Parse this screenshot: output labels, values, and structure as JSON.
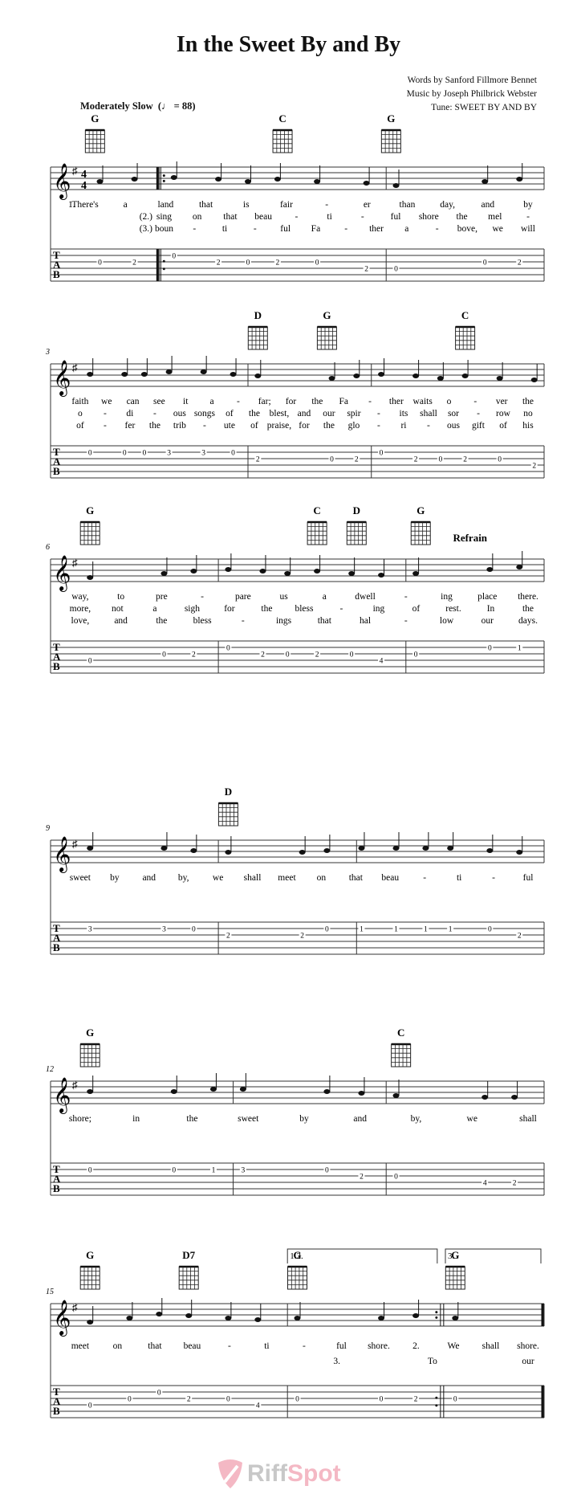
{
  "title": "In the Sweet By and By",
  "credits": {
    "words": "Words by Sanford Fillmore Bennet",
    "music": "Music by Joseph Philbrick Webster",
    "tune": "Tune: SWEET BY AND BY"
  },
  "tempo": {
    "label": "Moderately Slow",
    "bpm_text": "(♩ = 88)"
  },
  "refrain_label": "Refrain",
  "watermark": {
    "part1": "Riff",
    "part2": "Spot",
    "color1": "#c8c8c8",
    "color2": "#f4b8c4"
  },
  "systems": [
    {
      "number": "",
      "chords": [
        {
          "name": "G",
          "pos": 0.09
        },
        {
          "name": "C",
          "pos": 0.47
        },
        {
          "name": "G",
          "pos": 0.69
        }
      ],
      "barlines": [
        0.22,
        0.68
      ],
      "repeat_start_at": 0.22,
      "verse_labels": [
        "1.",
        "(2.)",
        "(3.)"
      ],
      "lyrics": [
        [
          "There's",
          "a",
          "land",
          "that",
          "is",
          "fair",
          "-",
          "er",
          "than",
          "day,",
          "and",
          "by"
        ],
        [
          "sing",
          "on",
          "that",
          "beau",
          "-",
          "ti",
          "-",
          "ful",
          "shore",
          "the",
          "mel",
          "-"
        ],
        [
          "boun",
          "-",
          "ti",
          "-",
          "ful",
          "Fa",
          "-",
          "ther",
          "a",
          "-",
          "bove,",
          "we",
          "will"
        ]
      ],
      "tab": [
        {
          "s": 3,
          "f": "0",
          "p": 0.1
        },
        {
          "s": 3,
          "f": "2",
          "p": 0.17
        },
        {
          "s": 2,
          "f": "0",
          "p": 0.25
        },
        {
          "s": 3,
          "f": "2",
          "p": 0.34
        },
        {
          "s": 3,
          "f": "0",
          "p": 0.4
        },
        {
          "s": 3,
          "f": "2",
          "p": 0.46
        },
        {
          "s": 3,
          "f": "0",
          "p": 0.54
        },
        {
          "s": 4,
          "f": "2",
          "p": 0.64
        },
        {
          "s": 4,
          "f": "0",
          "p": 0.7
        },
        {
          "s": 3,
          "f": "0",
          "p": 0.88
        },
        {
          "s": 3,
          "f": "2",
          "p": 0.95
        }
      ]
    },
    {
      "number": "3",
      "chords": [
        {
          "name": "D",
          "pos": 0.42
        },
        {
          "name": "G",
          "pos": 0.56
        },
        {
          "name": "C",
          "pos": 0.84
        }
      ],
      "barlines": [
        0.4,
        0.65
      ],
      "lyrics": [
        [
          "faith",
          "we",
          "can",
          "see",
          "it",
          "a",
          "-",
          "far;",
          "for",
          "the",
          "Fa",
          "-",
          "ther",
          "waits",
          "o",
          "-",
          "ver",
          "the"
        ],
        [
          "o",
          "-",
          "di",
          "-",
          "ous",
          "songs",
          "of",
          "the",
          "blest,",
          "and",
          "our",
          "spir",
          "-",
          "its",
          "shall",
          "sor",
          "-",
          "row",
          "no"
        ],
        [
          "of",
          "-",
          "fer",
          "the",
          "trib",
          "-",
          "ute",
          "of",
          "praise,",
          "for",
          "the",
          "glo",
          "-",
          "ri",
          "-",
          "ous",
          "gift",
          "of",
          "his"
        ]
      ],
      "tab": [
        {
          "s": 2,
          "f": "0",
          "p": 0.08
        },
        {
          "s": 2,
          "f": "0",
          "p": 0.15
        },
        {
          "s": 2,
          "f": "0",
          "p": 0.19
        },
        {
          "s": 2,
          "f": "3",
          "p": 0.24
        },
        {
          "s": 2,
          "f": "3",
          "p": 0.31
        },
        {
          "s": 2,
          "f": "0",
          "p": 0.37
        },
        {
          "s": 3,
          "f": "2",
          "p": 0.42
        },
        {
          "s": 3,
          "f": "0",
          "p": 0.57
        },
        {
          "s": 3,
          "f": "2",
          "p": 0.62
        },
        {
          "s": 2,
          "f": "0",
          "p": 0.67
        },
        {
          "s": 3,
          "f": "2",
          "p": 0.74
        },
        {
          "s": 3,
          "f": "0",
          "p": 0.79
        },
        {
          "s": 3,
          "f": "2",
          "p": 0.84
        },
        {
          "s": 3,
          "f": "0",
          "p": 0.91
        },
        {
          "s": 4,
          "f": "2",
          "p": 0.98
        }
      ]
    },
    {
      "number": "6",
      "chords": [
        {
          "name": "G",
          "pos": 0.08
        },
        {
          "name": "C",
          "pos": 0.54
        },
        {
          "name": "D",
          "pos": 0.62
        },
        {
          "name": "G",
          "pos": 0.75
        }
      ],
      "barlines": [
        0.34,
        0.72
      ],
      "lyrics": [
        [
          "way,",
          "to",
          "pre",
          "-",
          "pare",
          "us",
          "a",
          "dwell",
          "-",
          "ing",
          "place",
          "there."
        ],
        [
          "more,",
          "not",
          "a",
          "sigh",
          "for",
          "the",
          "bless",
          "-",
          "ing",
          "of",
          "rest.",
          "In",
          "the"
        ],
        [
          "love,",
          "and",
          "the",
          "bless",
          "-",
          "ings",
          "that",
          "hal",
          "-",
          "low",
          "our",
          "days."
        ]
      ],
      "tab": [
        {
          "s": 4,
          "f": "0",
          "p": 0.08
        },
        {
          "s": 3,
          "f": "0",
          "p": 0.23
        },
        {
          "s": 3,
          "f": "2",
          "p": 0.29
        },
        {
          "s": 2,
          "f": "0",
          "p": 0.36
        },
        {
          "s": 3,
          "f": "2",
          "p": 0.43
        },
        {
          "s": 3,
          "f": "0",
          "p": 0.48
        },
        {
          "s": 3,
          "f": "2",
          "p": 0.54
        },
        {
          "s": 3,
          "f": "0",
          "p": 0.61
        },
        {
          "s": 4,
          "f": "4",
          "p": 0.67
        },
        {
          "s": 3,
          "f": "0",
          "p": 0.74
        },
        {
          "s": 2,
          "f": "0",
          "p": 0.89
        },
        {
          "s": 2,
          "f": "1",
          "p": 0.95
        }
      ]
    },
    {
      "number": "9",
      "chords": [
        {
          "name": "D",
          "pos": 0.36
        }
      ],
      "barlines": [
        0.34,
        0.62
      ],
      "lyrics": [
        [
          "sweet",
          "by",
          "and",
          "by,",
          "we",
          "shall",
          "meet",
          "on",
          "that",
          "beau",
          "-",
          "ti",
          "-",
          "ful"
        ]
      ],
      "tab": [
        {
          "s": 2,
          "f": "3",
          "p": 0.08
        },
        {
          "s": 2,
          "f": "3",
          "p": 0.23
        },
        {
          "s": 2,
          "f": "0",
          "p": 0.29
        },
        {
          "s": 3,
          "f": "2",
          "p": 0.36
        },
        {
          "s": 3,
          "f": "2",
          "p": 0.51
        },
        {
          "s": 2,
          "f": "0",
          "p": 0.56
        },
        {
          "s": 2,
          "f": "1",
          "p": 0.63
        },
        {
          "s": 2,
          "f": "1",
          "p": 0.7
        },
        {
          "s": 2,
          "f": "1",
          "p": 0.76
        },
        {
          "s": 2,
          "f": "1",
          "p": 0.81
        },
        {
          "s": 2,
          "f": "0",
          "p": 0.89
        },
        {
          "s": 3,
          "f": "2",
          "p": 0.95
        }
      ]
    },
    {
      "number": "12",
      "chords": [
        {
          "name": "G",
          "pos": 0.08
        },
        {
          "name": "C",
          "pos": 0.71
        }
      ],
      "barlines": [
        0.37,
        0.68
      ],
      "lyrics": [
        [
          "shore;",
          "in",
          "the",
          "sweet",
          "by",
          "and",
          "by,",
          "we",
          "shall"
        ]
      ],
      "tab": [
        {
          "s": 2,
          "f": "0",
          "p": 0.08
        },
        {
          "s": 2,
          "f": "0",
          "p": 0.25
        },
        {
          "s": 2,
          "f": "1",
          "p": 0.33
        },
        {
          "s": 2,
          "f": "3",
          "p": 0.39
        },
        {
          "s": 2,
          "f": "0",
          "p": 0.56
        },
        {
          "s": 3,
          "f": "2",
          "p": 0.63
        },
        {
          "s": 3,
          "f": "0",
          "p": 0.7
        },
        {
          "s": 4,
          "f": "4",
          "p": 0.88
        },
        {
          "s": 4,
          "f": "2",
          "p": 0.94
        }
      ]
    },
    {
      "number": "15",
      "chords": [
        {
          "name": "G",
          "pos": 0.08
        },
        {
          "name": "D7",
          "pos": 0.28
        },
        {
          "name": "G",
          "pos": 0.5
        },
        {
          "name": "G",
          "pos": 0.82
        }
      ],
      "barlines": [
        0.48
      ],
      "repeat_end_at": 0.79,
      "endings": [
        {
          "label": "1.2.",
          "from": 0.48,
          "to": 0.79
        },
        {
          "label": "3.",
          "from": 0.8,
          "to": 1.0
        }
      ],
      "lyrics": [
        [
          "meet",
          "on",
          "that",
          "beau",
          "-",
          "ti",
          "-",
          "ful",
          "shore.",
          "2.",
          "We",
          "shall",
          "shore."
        ],
        [
          "3.",
          "To",
          "our"
        ]
      ],
      "tab": [
        {
          "s": 4,
          "f": "0",
          "p": 0.08
        },
        {
          "s": 3,
          "f": "0",
          "p": 0.16
        },
        {
          "s": 2,
          "f": "0",
          "p": 0.22
        },
        {
          "s": 3,
          "f": "2",
          "p": 0.28
        },
        {
          "s": 3,
          "f": "0",
          "p": 0.36
        },
        {
          "s": 4,
          "f": "4",
          "p": 0.42
        },
        {
          "s": 3,
          "f": "0",
          "p": 0.5
        },
        {
          "s": 3,
          "f": "0",
          "p": 0.67
        },
        {
          "s": 3,
          "f": "2",
          "p": 0.74
        },
        {
          "s": 3,
          "f": "0",
          "p": 0.82
        }
      ]
    }
  ]
}
